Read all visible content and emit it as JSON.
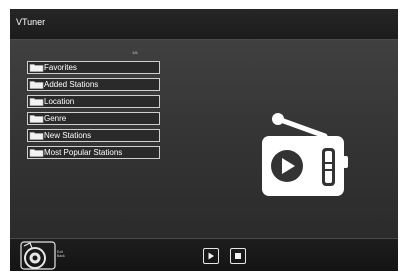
{
  "app": {
    "title": "VTuner"
  },
  "list": {
    "page_indicator": "1/6",
    "items": [
      {
        "label": "Favorites",
        "icon": "folder-icon"
      },
      {
        "label": "Added Stations",
        "icon": "folder-icon"
      },
      {
        "label": "Location",
        "icon": "folder-icon"
      },
      {
        "label": "Genre",
        "icon": "folder-icon"
      },
      {
        "label": "New Stations",
        "icon": "folder-icon"
      },
      {
        "label": "Most Popular Stations",
        "icon": "folder-icon"
      }
    ]
  },
  "preview": {
    "icon": "radio-icon"
  },
  "footer": {
    "exit_label": "Exit",
    "back_label": "Back",
    "play_icon": "play-icon",
    "stop_icon": "stop-icon"
  },
  "colors": {
    "background": "#2e2e2e",
    "bar": "#1a1a1a",
    "text": "#ffffff",
    "item_border": "#cfcfcf"
  }
}
